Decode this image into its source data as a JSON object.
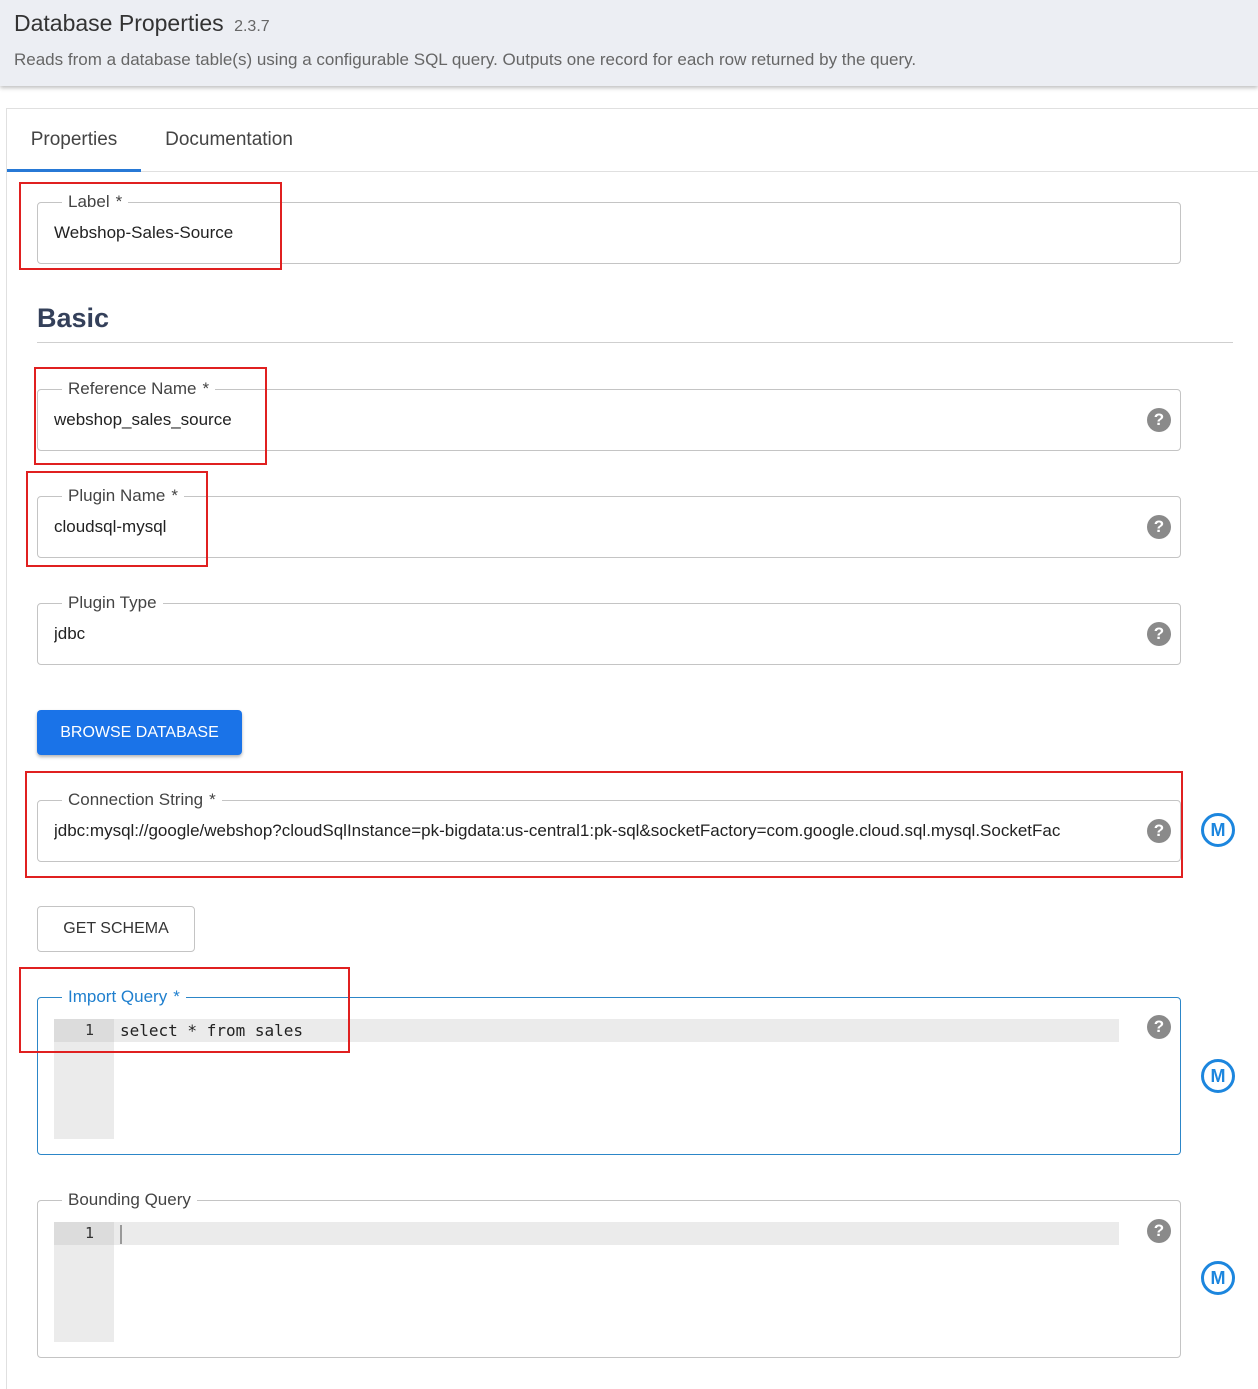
{
  "header": {
    "title": "Database Properties",
    "version": "2.3.7",
    "description": "Reads from a database table(s) using a configurable SQL query. Outputs one record for each row returned by the query."
  },
  "tabs": [
    {
      "label": "Properties",
      "active": true
    },
    {
      "label": "Documentation",
      "active": false
    }
  ],
  "fields": {
    "label": {
      "label": "Label",
      "required_mark": "*",
      "value": "Webshop-Sales-Source"
    },
    "reference_name": {
      "label": "Reference Name",
      "required_mark": "*",
      "value": "webshop_sales_source"
    },
    "plugin_name": {
      "label": "Plugin Name",
      "required_mark": "*",
      "value": "cloudsql-mysql"
    },
    "plugin_type": {
      "label": "Plugin Type",
      "value": "jdbc"
    },
    "connection_string": {
      "label": "Connection String",
      "required_mark": "*",
      "value": "jdbc:mysql://google/webshop?cloudSqlInstance=pk-bigdata:us-central1:pk-sql&socketFactory=com.google.cloud.sql.mysql.SocketFac"
    },
    "import_query": {
      "label": "Import Query",
      "required_mark": "*",
      "line_number": "1",
      "code": "select * from sales"
    },
    "bounding_query": {
      "label": "Bounding Query",
      "line_number": "1",
      "code": ""
    }
  },
  "section": {
    "basic_title": "Basic"
  },
  "buttons": {
    "browse_database": "BROWSE DATABASE",
    "get_schema": "GET SCHEMA"
  },
  "icons": {
    "help": "?",
    "macro": "M"
  },
  "colors": {
    "accent": "#1a73e8",
    "highlight_box": "#e02020",
    "focus": "#2c86c8"
  }
}
